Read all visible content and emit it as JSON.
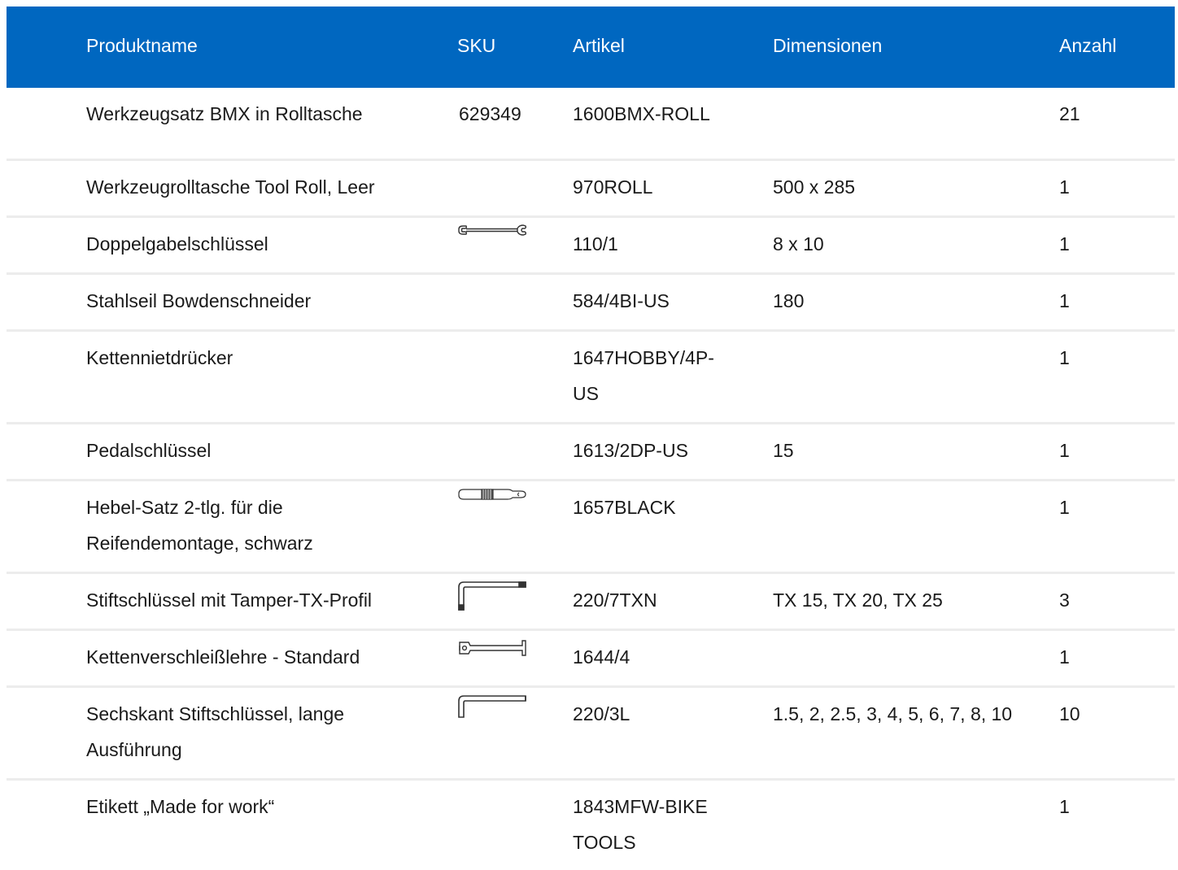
{
  "table": {
    "headers": {
      "name": "Produktname",
      "sku": "SKU",
      "article": "Artikel",
      "dimensions": "Dimensionen",
      "quantity": "Anzahl"
    },
    "rows": [
      {
        "name": "Werkzeugsatz BMX in Rolltasche",
        "sku": "629349",
        "icon": "",
        "article": "1600BMX-ROLL",
        "dimensions": "",
        "quantity": "21"
      },
      {
        "name": "Werkzeugrolltasche Tool Roll, Leer",
        "sku": "",
        "icon": "",
        "article": "970ROLL",
        "dimensions": "500 x 285",
        "quantity": "1"
      },
      {
        "name": "Doppelgabelschlüssel",
        "sku": "",
        "icon": "double-open-end-wrench-icon",
        "article": "110/1",
        "dimensions": "8 x 10",
        "quantity": "1"
      },
      {
        "name": "Stahlseil Bowdenschneider",
        "sku": "",
        "icon": "",
        "article": "584/4BI-US",
        "dimensions": "180",
        "quantity": "1"
      },
      {
        "name": "Kettennietdrücker",
        "sku": "",
        "icon": "",
        "article": "1647HOBBY/4P-US",
        "dimensions": "",
        "quantity": "1"
      },
      {
        "name": "Pedalschlüssel",
        "sku": "",
        "icon": "",
        "article": "1613/2DP-US",
        "dimensions": "15",
        "quantity": "1"
      },
      {
        "name": "Hebel-Satz 2-tlg. für die Reifendemontage, schwarz",
        "sku": "",
        "icon": "tire-lever-icon",
        "article": "1657BLACK",
        "dimensions": "",
        "quantity": "1"
      },
      {
        "name": "Stiftschlüssel mit Tamper-TX-Profil",
        "sku": "",
        "icon": "torx-key-icon",
        "article": "220/7TXN",
        "dimensions": "TX 15, TX 20, TX 25",
        "quantity": "3"
      },
      {
        "name": "Kettenverschleißlehre - Standard",
        "sku": "",
        "icon": "chain-wear-gauge-icon",
        "article": "1644/4",
        "dimensions": "",
        "quantity": "1"
      },
      {
        "name": "Sechskant Stiftschlüssel, lange Ausführung",
        "sku": "",
        "icon": "hex-key-icon",
        "article": "220/3L",
        "dimensions": "1.5, 2, 2.5, 3, 4, 5, 6, 7, 8, 10",
        "quantity": "10"
      },
      {
        "name": "Etikett „Made for work“",
        "sku": "",
        "icon": "",
        "article": "1843MFW-BIKE TOOLS",
        "dimensions": "",
        "quantity": "1"
      }
    ]
  },
  "colors": {
    "header_background": "#0067c0",
    "header_text": "#ffffff",
    "row_divider": "#ececec"
  }
}
